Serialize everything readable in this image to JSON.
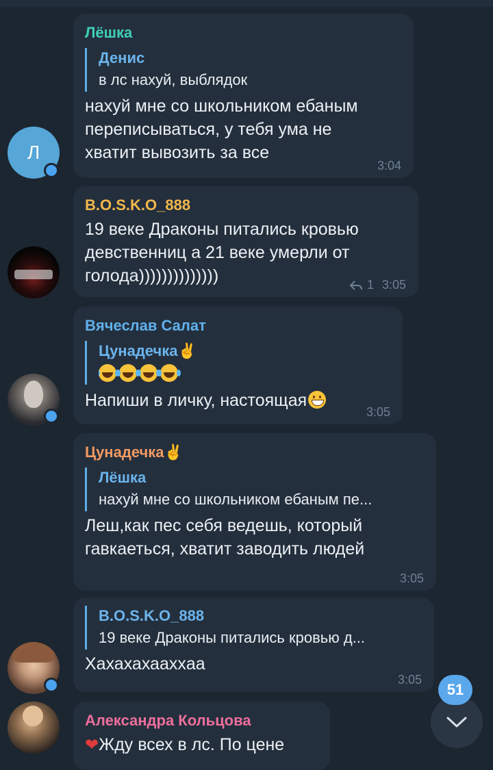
{
  "colors": {
    "background": "#1c2631",
    "bubble": "#242f3d",
    "accent": "#5aa7ec",
    "name_lyoshka": "#3fd0b8",
    "name_bosko": "#f2b84a",
    "name_vyacheslav": "#5fb1ec",
    "name_tsunadechka": "#f29a62",
    "name_aleksandra": "#ee6e9c"
  },
  "messages": [
    {
      "sender": "Лёшка",
      "avatar_letter": "Л",
      "reply_name": "Денис",
      "reply_text": "в лс нахуй, выблядок",
      "lines": [
        "нахуй мне со школьником ебаным",
        "переписываться, у тебя ума не",
        "хватит вывозить за все"
      ],
      "time": "3:04"
    },
    {
      "sender": "B.O.S.K.O_888",
      "lines": [
        "19 веке Драконы питались кровью",
        "девственниц а 21 веке умерли от",
        "голода))))))))))))))"
      ],
      "reply_count": "1",
      "time": "3:05"
    },
    {
      "sender": "Вячеслав Салат",
      "reply_name": "Цунадечка",
      "reply_emoji_icon": "laughing-tears-emoji x4",
      "text": "Напиши в личку, настоящая",
      "time": "3:05"
    },
    {
      "sender": "Цунадечка",
      "reply_name": "Лёшка",
      "reply_text": "нахуй мне со школьником ебаным пе...",
      "lines": [
        "Леш,как пес себя ведешь, который",
        "гавкаеться, хватит заводить людей"
      ],
      "time": "3:05"
    },
    {
      "reply_name": "B.O.S.K.O_888",
      "reply_text": "19 веке Драконы питались кровью д...",
      "text": "Хахахахаахxаа",
      "time": "3:05"
    },
    {
      "sender": "Александра Кольцова",
      "text": "Жду всех в лс. По цене"
    }
  ],
  "unread_badge": "51",
  "icons": {
    "scroll_down": "chevron-down-icon",
    "reply_arrow": "reply-arrow-icon",
    "victory_hand": "victory-hand-emoji"
  }
}
